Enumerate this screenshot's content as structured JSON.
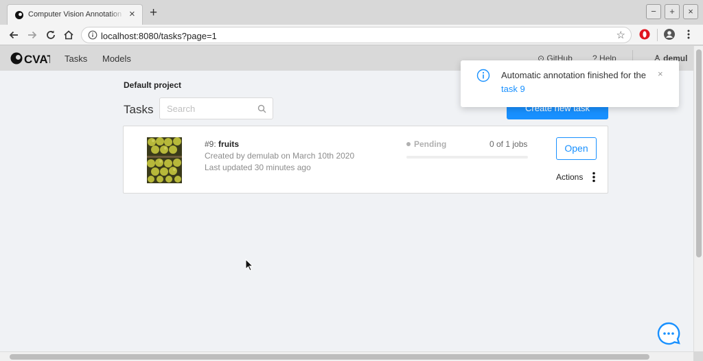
{
  "browser": {
    "tab_title": "Computer Vision Annotation Tool",
    "tab_close": "×",
    "new_tab": "+",
    "window_buttons": [
      "−",
      "+",
      "×"
    ],
    "url": "localhost:8080/tasks?page=1"
  },
  "header": {
    "logo": "CVAT",
    "nav": [
      "Tasks",
      "Models"
    ],
    "github": "GitHub",
    "help": "Help",
    "user": "demul"
  },
  "main": {
    "project": "Default project",
    "tasks_title": "Tasks",
    "search_placeholder": "Search",
    "create_button": "Create new task"
  },
  "task": {
    "id": "#9:",
    "name": "fruits",
    "created": "Created by demulab on March 10th 2020",
    "updated": "Last updated 30 minutes ago",
    "status": "Pending",
    "jobs": "0 of 1 jobs",
    "progress": 0,
    "open_button": "Open",
    "actions": "Actions"
  },
  "notification": {
    "message": "Automatic annotation finished for the",
    "link": "task 9",
    "close": "×"
  },
  "colors": {
    "accent": "#1890ff",
    "header_bg": "#d9d9d9",
    "page_bg": "#f0f2f5"
  }
}
